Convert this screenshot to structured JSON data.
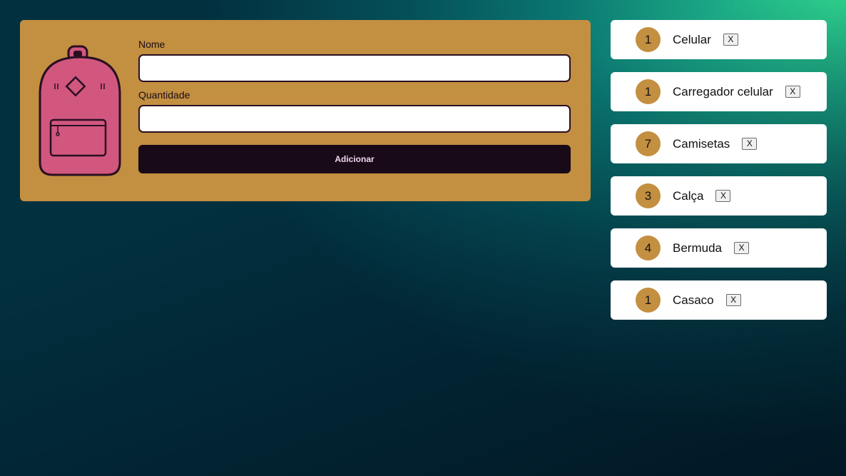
{
  "form": {
    "name_label": "Nome",
    "name_value": "",
    "quantity_label": "Quantidade",
    "quantity_value": "",
    "submit_label": "Adicionar",
    "backpack_icon": "backpack-icon"
  },
  "items": [
    {
      "quantity": "1",
      "name": "Celular",
      "remove_label": "X"
    },
    {
      "quantity": "1",
      "name": "Carregador celular",
      "remove_label": "X"
    },
    {
      "quantity": "7",
      "name": "Camisetas",
      "remove_label": "X"
    },
    {
      "quantity": "3",
      "name": "Calça",
      "remove_label": "X"
    },
    {
      "quantity": "4",
      "name": "Bermuda",
      "remove_label": "X"
    },
    {
      "quantity": "1",
      "name": "Casaco",
      "remove_label": "X"
    }
  ],
  "colors": {
    "form_background": "#c38f40",
    "button_background": "#180a17",
    "backpack_pink": "#d1577e",
    "badge": "#c38f40",
    "gradient_accent": "#2fd690"
  }
}
